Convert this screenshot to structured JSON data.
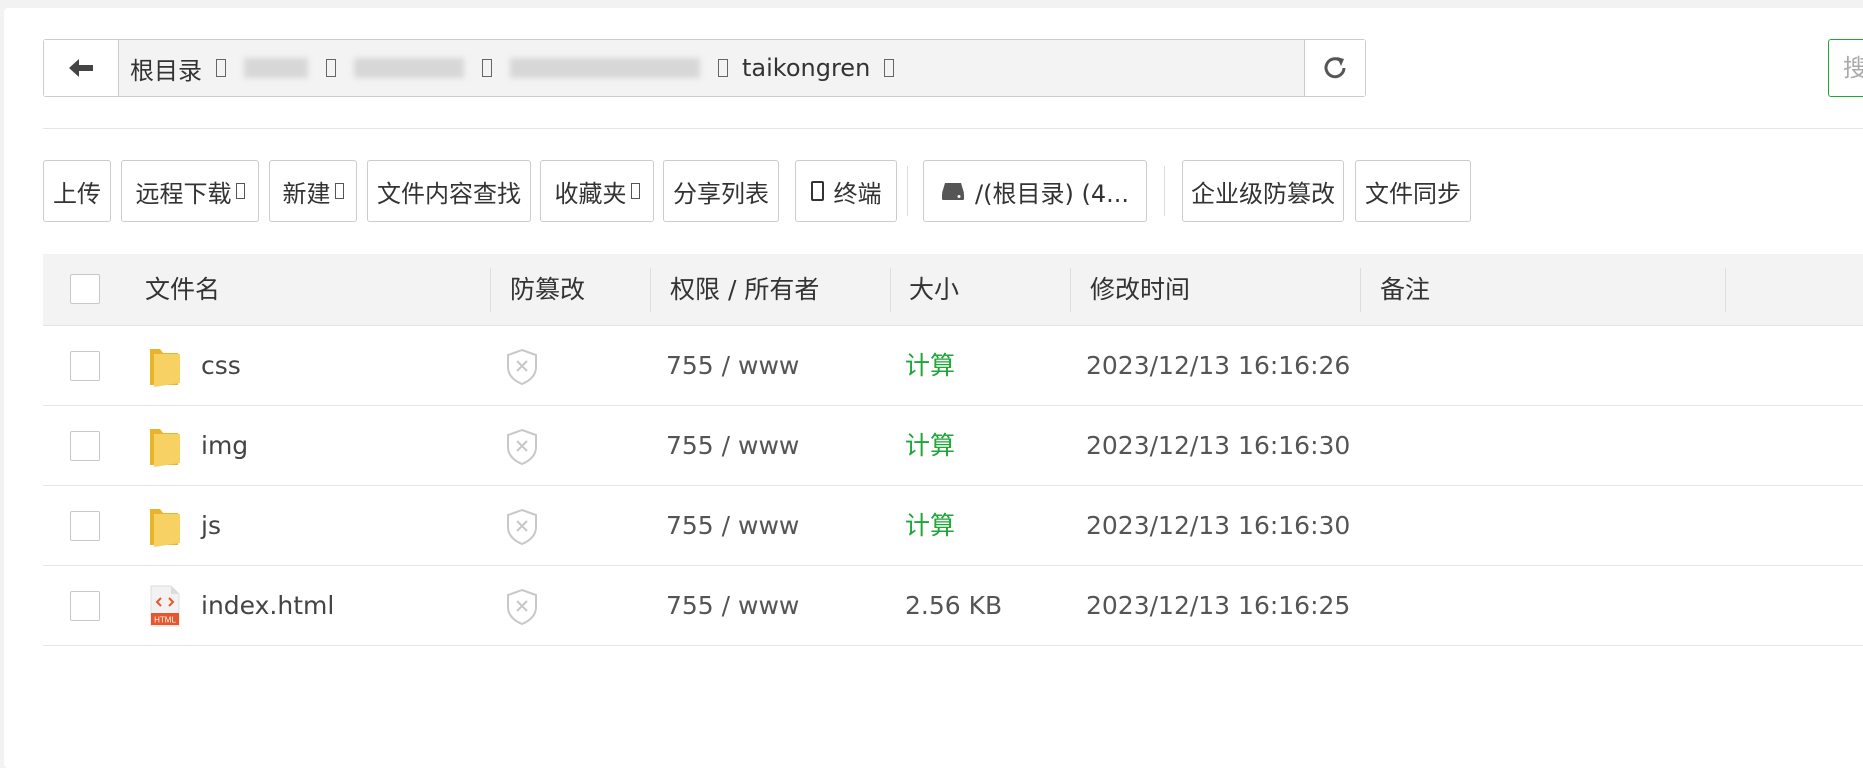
{
  "path": {
    "root_label": "根目录",
    "segments": [
      {
        "label": "www",
        "obscured": true
      },
      {
        "label": "www.set",
        "obscured": true
      },
      {
        "label": "",
        "obscured": true
      },
      {
        "label": "taikongren",
        "obscured": false
      }
    ]
  },
  "search": {
    "placeholder": "搜"
  },
  "toolbar": {
    "upload": "上传",
    "remote_download": "远程下载",
    "new": "新建",
    "content_search": "文件内容查找",
    "favorites": "收藏夹",
    "share_list": "分享列表",
    "terminal": "终端",
    "disk": "/(根目录) (4...",
    "enterprise_tamper": "企业级防篡改",
    "file_sync": "文件同步"
  },
  "table": {
    "headers": {
      "name": "文件名",
      "tamper": "防篡改",
      "perm_owner": "权限 / 所有者",
      "size": "大小",
      "mtime": "修改时间",
      "note": "备注"
    },
    "rows": [
      {
        "name": "css",
        "type": "folder",
        "perm": "755 / www",
        "size": "计算",
        "size_is_action": true,
        "mtime": "2023/12/13 16:16:26",
        "note": ""
      },
      {
        "name": "img",
        "type": "folder",
        "perm": "755 / www",
        "size": "计算",
        "size_is_action": true,
        "mtime": "2023/12/13 16:16:30",
        "note": ""
      },
      {
        "name": "js",
        "type": "folder",
        "perm": "755 / www",
        "size": "计算",
        "size_is_action": true,
        "mtime": "2023/12/13 16:16:30",
        "note": ""
      },
      {
        "name": "index.html",
        "type": "html",
        "perm": "755 / www",
        "size": "2.56 KB",
        "size_is_action": false,
        "mtime": "2023/12/13 16:16:25",
        "note": ""
      }
    ],
    "html_badge": "HTML"
  },
  "colors": {
    "accent": "#20a53a",
    "folder": "#f7c948",
    "html_icon": "#e9562b"
  }
}
